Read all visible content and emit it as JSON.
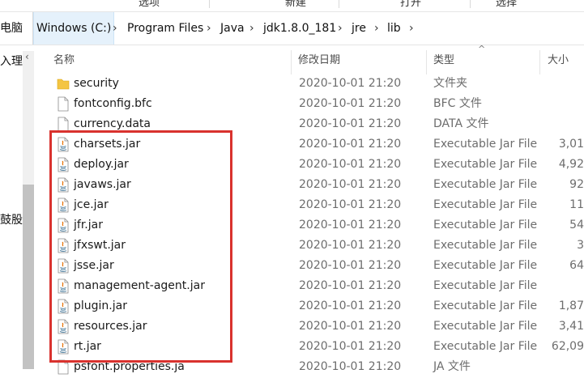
{
  "ribbon": {
    "labels": [
      "选项",
      "新建",
      "打开",
      "选择"
    ]
  },
  "address_bar": {
    "left_fragment": "电脑",
    "crumbs": [
      "Windows (C:)",
      "Program Files",
      "Java",
      "jdk1.8.0_181",
      "jre",
      "lib"
    ]
  },
  "nav_pane": {
    "items": [
      "入理",
      "鼓股"
    ]
  },
  "columns": {
    "name": "名称",
    "date": "修改日期",
    "type": "类型",
    "size": "大小"
  },
  "files": [
    {
      "name": "security",
      "icon": "folder-icon",
      "date": "2020-10-01 21:20",
      "type": "文件夹",
      "size": ""
    },
    {
      "name": "fontconfig.bfc",
      "icon": "file-icon",
      "date": "2020-10-01 21:20",
      "type": "BFC 文件",
      "size": ""
    },
    {
      "name": "currency.data",
      "icon": "file-icon",
      "date": "2020-10-01 21:20",
      "type": "DATA 文件",
      "size": ""
    },
    {
      "name": "charsets.jar",
      "icon": "jar-icon",
      "date": "2020-10-01 21:20",
      "type": "Executable Jar File",
      "size": "3,01"
    },
    {
      "name": "deploy.jar",
      "icon": "jar-icon",
      "date": "2020-10-01 21:20",
      "type": "Executable Jar File",
      "size": "4,92"
    },
    {
      "name": "javaws.jar",
      "icon": "jar-icon",
      "date": "2020-10-01 21:20",
      "type": "Executable Jar File",
      "size": "92"
    },
    {
      "name": "jce.jar",
      "icon": "jar-icon",
      "date": "2020-10-01 21:20",
      "type": "Executable Jar File",
      "size": "11"
    },
    {
      "name": "jfr.jar",
      "icon": "jar-icon",
      "date": "2020-10-01 21:20",
      "type": "Executable Jar File",
      "size": "54"
    },
    {
      "name": "jfxswt.jar",
      "icon": "jar-icon",
      "date": "2020-10-01 21:20",
      "type": "Executable Jar File",
      "size": "3"
    },
    {
      "name": "jsse.jar",
      "icon": "jar-icon",
      "date": "2020-10-01 21:20",
      "type": "Executable Jar File",
      "size": "64"
    },
    {
      "name": "management-agent.jar",
      "icon": "jar-icon",
      "date": "2020-10-01 21:20",
      "type": "Executable Jar File",
      "size": ""
    },
    {
      "name": "plugin.jar",
      "icon": "jar-icon",
      "date": "2020-10-01 21:20",
      "type": "Executable Jar File",
      "size": "1,87"
    },
    {
      "name": "resources.jar",
      "icon": "jar-icon",
      "date": "2020-10-01 21:20",
      "type": "Executable Jar File",
      "size": "3,41"
    },
    {
      "name": "rt.jar",
      "icon": "jar-icon",
      "date": "2020-10-01 21:20",
      "type": "Executable Jar File",
      "size": "62,09"
    },
    {
      "name": "psfont.properties.ja",
      "icon": "file-icon",
      "date": "2020-10-01 21:20",
      "type": "JA 文件",
      "size": ""
    }
  ],
  "colors": {
    "highlight": "#d9322e",
    "folder": "#f4c542",
    "jar_accent": "#e76f00",
    "java_blue": "#5382a1"
  }
}
